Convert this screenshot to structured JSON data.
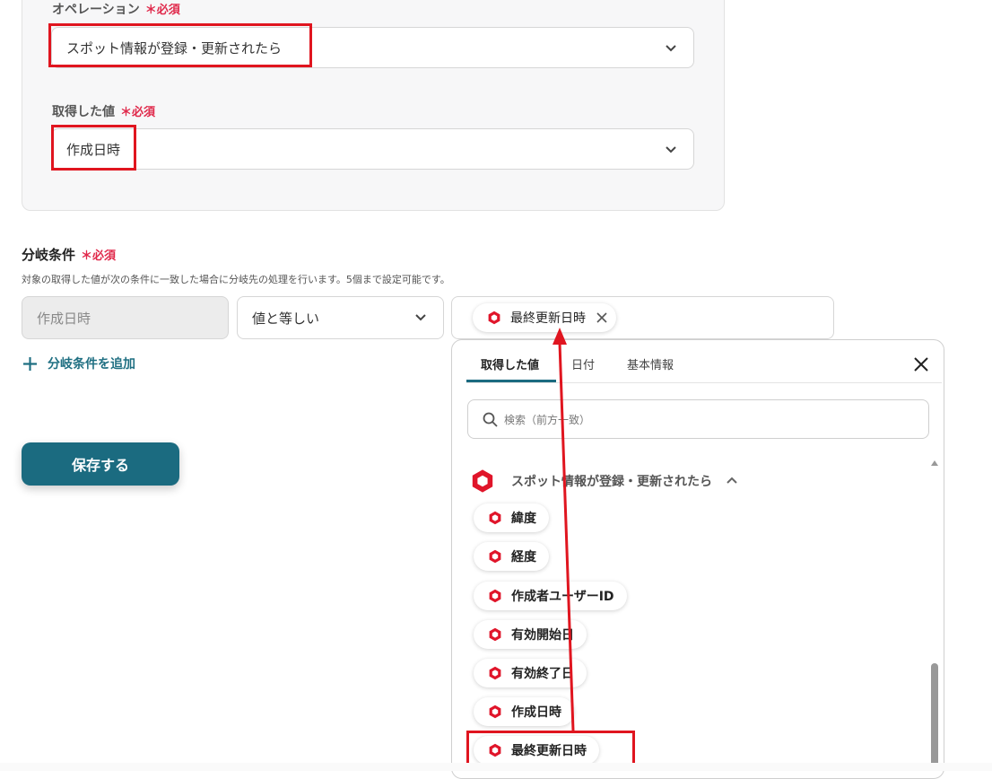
{
  "operation": {
    "label": "オペレーション",
    "required": "＊必須",
    "value": "スポット情報が登録・更新されたら"
  },
  "acquired_value": {
    "label": "取得した値",
    "required": "＊必須",
    "value": "作成日時"
  },
  "branch": {
    "title": "分岐条件",
    "required": "＊必須",
    "description": "対象の取得した値が次の条件に一致した場合に分岐先の処理を行います。5個まで設定可能です。",
    "field": "作成日時",
    "operator": "値と等しい",
    "selected_value": "最終更新日時",
    "add_label": "分岐条件を追加"
  },
  "save_label": "保存する",
  "picker": {
    "tabs": [
      "取得した値",
      "日付",
      "基本情報"
    ],
    "active_tab": "取得した値",
    "search_placeholder": "検索（前方一致）",
    "group_title": "スポット情報が登録・更新されたら",
    "items": [
      "緯度",
      "経度",
      "作成者ユーザーID",
      "有効開始日",
      "有効終了日",
      "作成日時",
      "最終更新日時"
    ]
  },
  "colors": {
    "accent": "#1b6b80",
    "required": "#e0284a",
    "highlight": "#e0151f",
    "app_icon": "#e0152a"
  }
}
